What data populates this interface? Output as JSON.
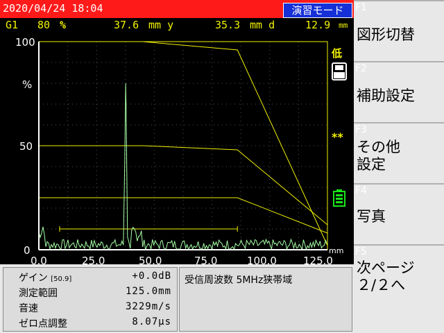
{
  "status_bar": {
    "datetime": "2020/04/24 18:04",
    "mode": "演習モード"
  },
  "readings": {
    "gain_index": "G1",
    "percent_value": "80",
    "percent_unit": "%",
    "y_value": "37.6",
    "y_unit": "mm y",
    "d_value": "35.3",
    "d_unit": "mm d",
    "x_value": "12.9",
    "x_unit": "mm"
  },
  "plot": {
    "y_tick_labels": [
      "100",
      "%",
      "50",
      "0"
    ],
    "x_tick_labels": [
      "0.0",
      "25.0",
      "50.0",
      "75.0",
      "100.0",
      "125.0"
    ],
    "x_unit": "mm",
    "x_range": [
      0,
      125
    ],
    "y_range": [
      0,
      100
    ],
    "curves": [
      {
        "points": [
          [
            0,
            100
          ],
          [
            45,
            100
          ],
          [
            86,
            96
          ],
          [
            125,
            2
          ]
        ]
      },
      {
        "points": [
          [
            0,
            50
          ],
          [
            45,
            50
          ],
          [
            86,
            48
          ],
          [
            125,
            12
          ]
        ]
      },
      {
        "points": [
          [
            0,
            25
          ],
          [
            45,
            25
          ],
          [
            86,
            25
          ],
          [
            125,
            8
          ]
        ]
      }
    ],
    "peak_mm": 37.6,
    "peak_height_percent": 80,
    "gate": {
      "start_mm": 9,
      "end_mm": 86,
      "level_percent": 10
    },
    "line_color": "#f2f200",
    "echo_color": "#a6ffa6"
  },
  "indicators": {
    "low": "低",
    "stars": "**",
    "icon_names": [
      "memory-card-icon",
      "battery-icon"
    ]
  },
  "function_keys": [
    {
      "key": "F1",
      "label": "図形切替"
    },
    {
      "key": "F2",
      "label": "補助設定"
    },
    {
      "key": "F3",
      "label": "その他\n設定"
    },
    {
      "key": "F4",
      "label": "写真"
    },
    {
      "key": "F5",
      "label": "次ページ\n２/２へ"
    }
  ],
  "settings": {
    "gain": {
      "label": "ゲイン",
      "tag": "[50.9]",
      "value": "+0.0dB"
    },
    "range": {
      "label": "測定範囲",
      "value": "125.0mm"
    },
    "velocity": {
      "label": "音速",
      "value": "3229m/s"
    },
    "zero": {
      "label": "ゼロ点調整",
      "value": "8.07μs"
    }
  },
  "probe_info": "受信周波数 5MHz狭帯域"
}
